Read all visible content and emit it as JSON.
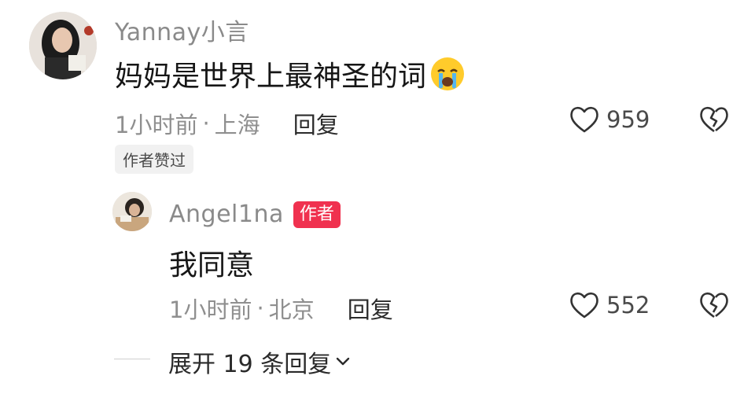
{
  "comment": {
    "username": "Yannay小言",
    "text": "妈妈是世界上最神圣的词",
    "emoji": "crying-face-emoji",
    "time": "1小时前",
    "separator": "·",
    "location": "上海",
    "reply_label": "回复",
    "like_count": "959",
    "author_liked_label": "作者赞过"
  },
  "reply": {
    "username": "Angel1na",
    "author_badge": "作者",
    "text": "我同意",
    "time": "1小时前",
    "separator": "·",
    "location": "北京",
    "reply_label": "回复",
    "like_count": "552"
  },
  "expand": {
    "label": "展开 19 条回复"
  },
  "colors": {
    "author_badge_bg": "#f0314f",
    "username": "#8a8a8a",
    "meta": "#8f8f8f"
  }
}
